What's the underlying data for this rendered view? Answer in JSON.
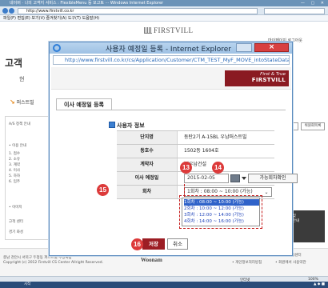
{
  "background_window": {
    "title": "네이버 · 나의 고객지  서비스 : FlexibleMenu 등 모고토 ··· Windows Internet Explorer",
    "url": "http://www.firstvill.co.kr",
    "menu": "파일(F)  편집(E)  보기(V)  즐겨찾기(A)  도구(T)  도움말(H)",
    "logo": "FIRSTVILL",
    "top_links": "마이페이지  로그아웃",
    "big_title": "고객",
    "left_fragment": "현",
    "tab": "퍼스트빌",
    "left_panel_rows": [
      "A/S 정책 안내",
      "• 이용 안내",
      "1. 접수",
      "2. 소유",
      "3. 계약",
      "4. 이사",
      "5. 하자",
      "6. 입주",
      "• 이미지",
      "고객 센터",
      "경기 화성"
    ],
    "right_buttons": [
      "",
      "위원회목록"
    ],
    "right_dark_text": "이사 및\n입주 안내\n안내",
    "footer": {
      "company": "Woonam",
      "left_text": "충남 천안시 서북구 두정동 퍼스트빌 주상복합",
      "copyright": "Copyright (c) 2012 Firstvill CS Center Allright Reserved.",
      "right_text1": "• 퍼스트빌 고객센터",
      "right_text2": "• 개인정보처리방침",
      "right_text3": "• 회원에서 사용약관"
    },
    "taskbar": "시작",
    "status_zone": "인터넷",
    "zoom": "100%"
  },
  "popup": {
    "title": "사용자 예정일 등록 - Internet Explorer",
    "close_glyph": "×",
    "url": "http://www.firstvill.co.kr/cs/Application/Customer/CTM_TEST_MyF_MOVE_intoStateData",
    "brand_line1": "First & True",
    "brand_line2": "FIRSTVILL",
    "tab_label": "이사 예정일 등록",
    "section_title": "사용자 정보",
    "rows": [
      {
        "label": "단지명",
        "value": "동탄2기 A-15BL 우남퍼스트빌"
      },
      {
        "label": "동호수",
        "value": "1502동 1604호"
      },
      {
        "label": "계약자",
        "value": "㈜우남건설"
      },
      {
        "label": "이사 예정일",
        "value": ""
      },
      {
        "label": "회차",
        "value": ""
      }
    ],
    "date_value": "2015-02-05",
    "check_button": "가능회차확인",
    "round_selected": "1회차 : 08:00 ~ 10:00 (가능)",
    "round_options": [
      "1회차 : 08:00 ~ 10:00 (가능)",
      "2회차 : 10:00 ~ 12:00 (가능)",
      "3회차 : 12:00 ~ 14:00 (가능)",
      "4회차 : 14:00 ~ 16:00 (가능)"
    ],
    "save_button": "저장",
    "cancel_button": "취소"
  },
  "badges": [
    "13",
    "14",
    "15",
    "16"
  ],
  "colors": {
    "badge": "#dc3a3a",
    "brand": "#8a1a22",
    "save_button": "#9c1d24",
    "selected_option": "#2f62c9",
    "dash_annotation": "#c61b1b"
  }
}
